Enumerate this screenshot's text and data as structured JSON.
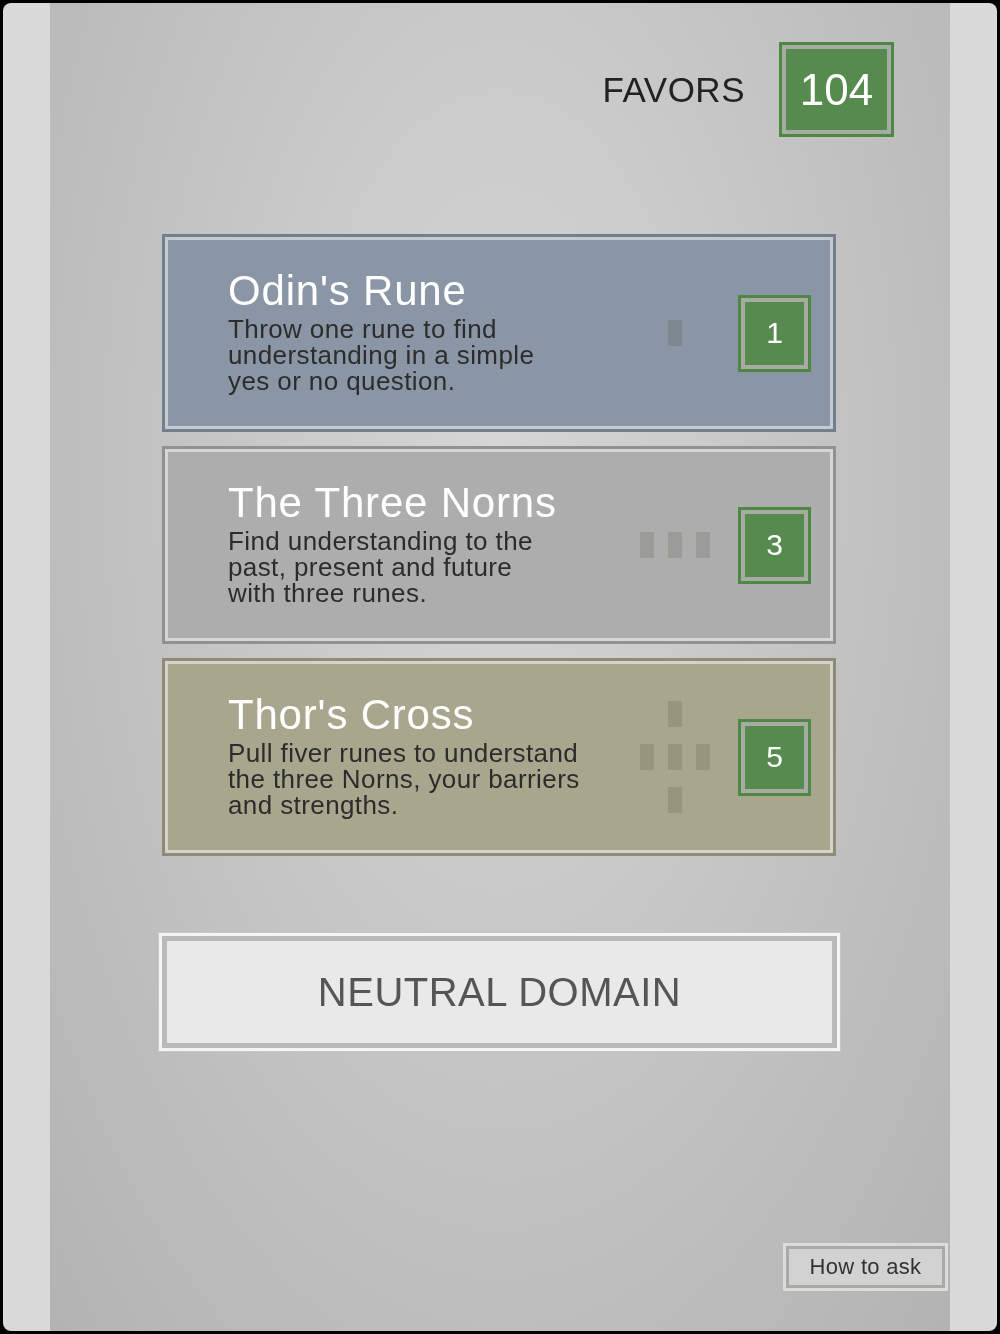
{
  "header": {
    "label": "FAVORS",
    "count": "104"
  },
  "spreads": [
    {
      "title": "Odin's Rune",
      "description_lines": [
        "Throw one rune to find",
        "understanding in a simple",
        "yes or no question."
      ],
      "cost": "1",
      "kind": "single",
      "color": "#8a96a5"
    },
    {
      "title": "The Three Norns",
      "description_lines": [
        "Find understanding to the",
        "past, present and future",
        "with three runes."
      ],
      "cost": "3",
      "kind": "line",
      "color": "#adadad"
    },
    {
      "title": "Thor's Cross",
      "description_lines": [
        "Pull fiver runes to understand",
        "the three Norns, your barriers",
        "and strengths."
      ],
      "cost": "5",
      "kind": "cross",
      "color": "#a8a78e"
    }
  ],
  "domain_button": {
    "label": "NEUTRAL DOMAIN"
  },
  "help_button": {
    "label": "How to ask"
  }
}
